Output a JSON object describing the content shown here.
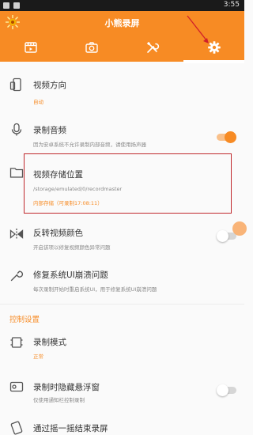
{
  "status_bar": {
    "time": "3:55"
  },
  "app": {
    "title": "小熊录屏"
  },
  "tabs": [
    {
      "icon": "video-list-icon",
      "active": false
    },
    {
      "icon": "camera-icon",
      "active": false
    },
    {
      "icon": "tools-icon",
      "active": false
    },
    {
      "icon": "gear-icon",
      "active": true
    }
  ],
  "settings": {
    "orientation": {
      "title": "视频方向",
      "value": "自动"
    },
    "record_audio": {
      "title": "录制音频",
      "subtitle": "因为安卓系统不允许录制内部音频，请使用扬声器",
      "enabled": true
    },
    "storage": {
      "title": "视频存储位置",
      "path": "/storage/emulated/0/recordmaster",
      "free": "内部存储（可录制17:08:11）"
    },
    "invert_color": {
      "title": "反转视频颜色",
      "subtitle": "开启该项以修复视频颜色异常问题",
      "enabled": false
    },
    "fix_crash": {
      "title": "修复系统UI崩溃问题",
      "subtitle": "每次录制开始时重启系统UI，用于修复系统UI崩溃问题"
    }
  },
  "control_section": {
    "header": "控制设置",
    "record_mode": {
      "title": "录制模式",
      "value": "正常"
    },
    "hide_float": {
      "title": "录制时隐藏悬浮窗",
      "subtitle": "仅使用通知栏控制录制",
      "enabled": false
    },
    "shake_stop": {
      "title": "通过摇一摇结束录屏"
    }
  },
  "colors": {
    "accent": "#f78b24",
    "highlight_box": "#c0292d"
  }
}
